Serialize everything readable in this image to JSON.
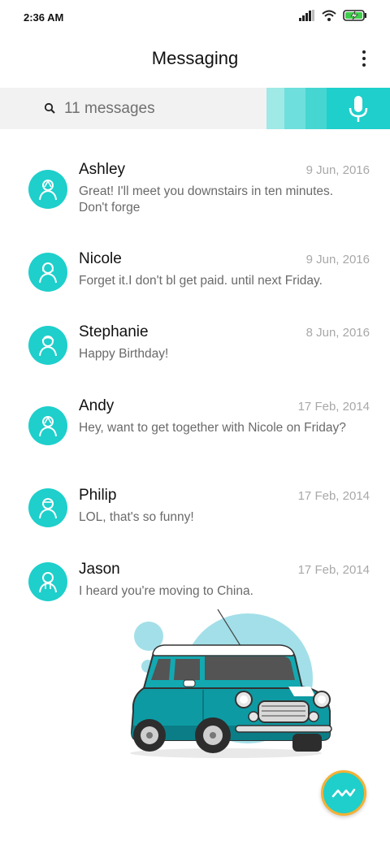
{
  "status_bar": {
    "time": "2:36 AM"
  },
  "header": {
    "title": "Messaging"
  },
  "search": {
    "placeholder": "11 messages"
  },
  "colors": {
    "accent": "#1ecfcb",
    "fab_border": "#f4b134"
  },
  "icons": {
    "status": [
      "signal-icon",
      "wifi-icon",
      "battery-charging-icon"
    ],
    "header": "more-vert-icon",
    "search": "search-icon",
    "voice": "mic-icon",
    "fab": "compose-icon"
  },
  "conversations": [
    {
      "name": "Ashley",
      "date": "9 Jun, 2016",
      "preview": "Great! I'll meet you downstairs in ten minutes. Don't forge",
      "avatar_icon": "person-avatar-icon"
    },
    {
      "name": "Nicole",
      "date": "9 Jun, 2016",
      "preview": "Forget it.I don't bl get paid. until next Friday.",
      "avatar_icon": "person-avatar-icon"
    },
    {
      "name": "Stephanie",
      "date": "8 Jun, 2016",
      "preview": "Happy Birthday!",
      "avatar_icon": "person-avatar-icon"
    },
    {
      "name": "Andy",
      "date": "17 Feb, 2014",
      "preview": "Hey, want to get together with Nicole on Friday?",
      "avatar_icon": "person-avatar-icon"
    },
    {
      "name": "Philip",
      "date": "17 Feb, 2014",
      "preview": "LOL, that's so funny!",
      "avatar_icon": "person-avatar-icon"
    },
    {
      "name": "Jason",
      "date": "17 Feb, 2014",
      "preview": "I heard you're moving to China.",
      "avatar_icon": "person-avatar-icon"
    }
  ]
}
